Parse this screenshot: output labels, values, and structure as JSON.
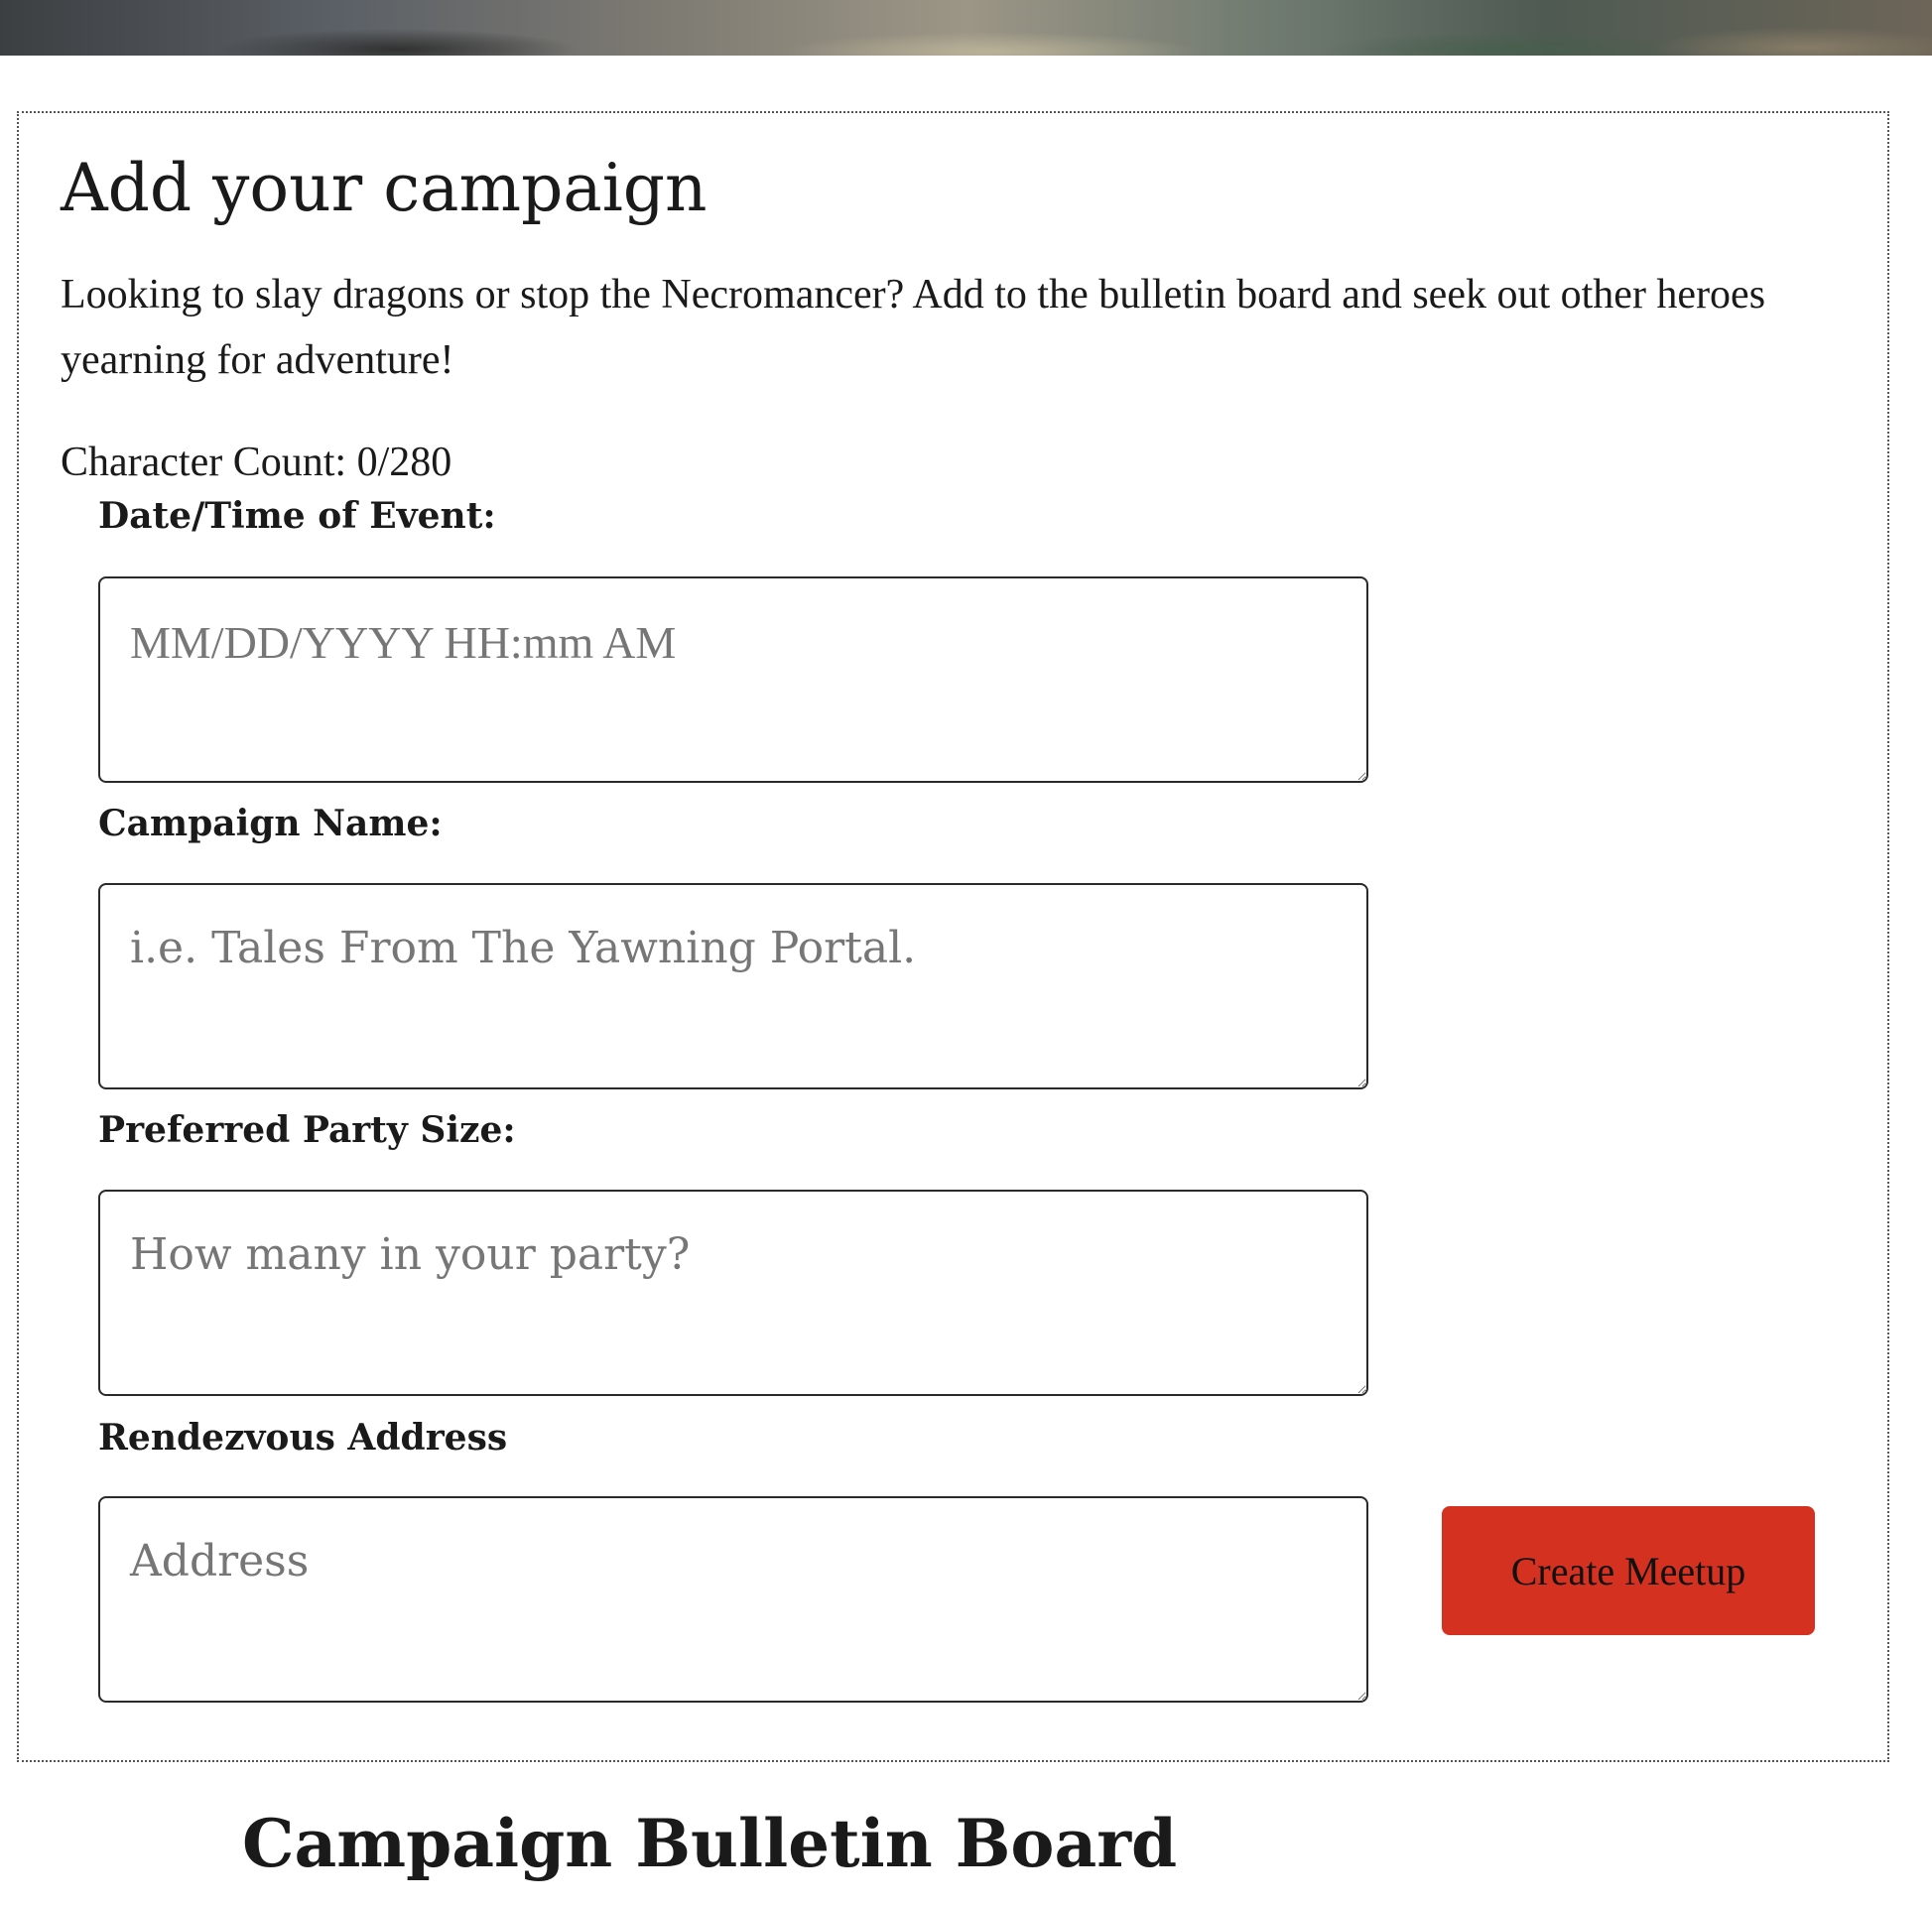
{
  "form": {
    "title": "Add your campaign",
    "intro": "Looking to slay dragons or stop the Necromancer? Add to the bulletin board and seek out other heroes yearning for adventure!",
    "character_count": "Character Count: 0/280",
    "fields": [
      {
        "label": "Date/Time of Event:",
        "value": "",
        "placeholder": "MM/DD/YYYY HH:mm AM"
      },
      {
        "label": "Campaign Name:",
        "value": "",
        "placeholder": "i.e. Tales From The Yawning Portal."
      },
      {
        "label": "Preferred Party Size:",
        "value": "",
        "placeholder": "How many in your party?"
      },
      {
        "label": "Rendezvous Address",
        "value": "",
        "placeholder": "Address"
      }
    ],
    "submit_label": "Create Meetup"
  },
  "board": {
    "title": "Campaign Bulletin Board"
  },
  "colors": {
    "submit_button_bg": "#d43120",
    "placeholder_text": "#767676",
    "panel_border": "#555555"
  }
}
